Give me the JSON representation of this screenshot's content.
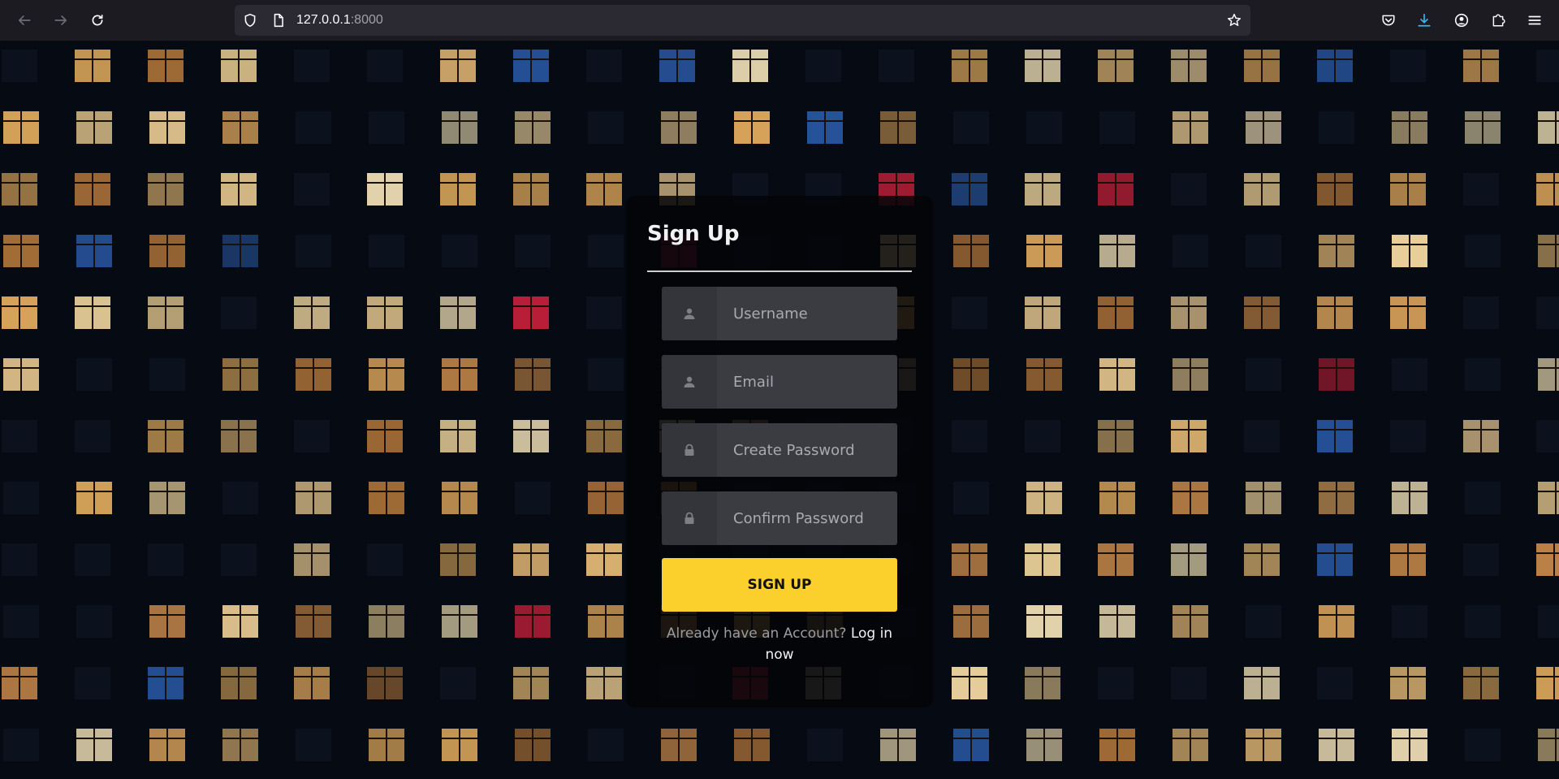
{
  "browser": {
    "url_host": "127.0.0.1",
    "url_port": ":8000",
    "icons": {
      "back": "back-arrow-icon",
      "forward": "forward-arrow-icon",
      "reload": "reload-icon",
      "tracking": "shield-icon",
      "page": "page-icon",
      "bookmark": "star-icon",
      "pocket": "pocket-icon",
      "downloads": "download-icon",
      "account": "account-icon",
      "extensions": "puzzle-icon",
      "menu": "hamburger-menu-icon"
    }
  },
  "form": {
    "title": "Sign Up",
    "fields": [
      {
        "placeholder": "Username",
        "icon": "user-icon"
      },
      {
        "placeholder": "Email",
        "icon": "user-icon"
      },
      {
        "placeholder": "Create Password",
        "icon": "lock-icon"
      },
      {
        "placeholder": "Confirm Password",
        "icon": "lock-icon"
      }
    ],
    "submit_label": "SIGN UP",
    "footer_prompt": "Already have an Account?",
    "footer_link": "Log in now"
  },
  "colors": {
    "accent": "#fbcf2c",
    "field_bg": "#3a3c41",
    "card_bg": "#040508",
    "page_bg": "#060a12"
  }
}
